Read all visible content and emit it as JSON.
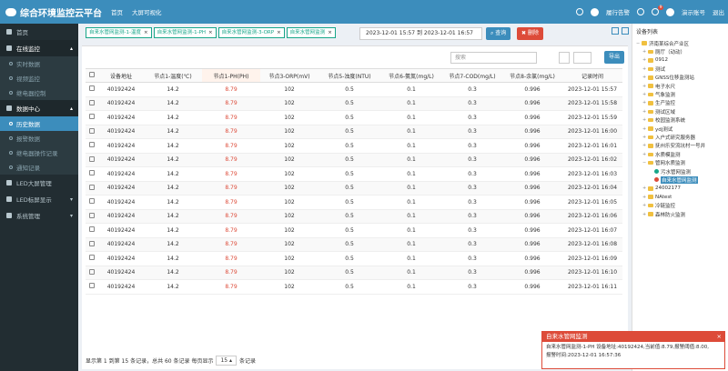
{
  "header": {
    "title": "综合环境监控云平台",
    "nav": [
      "首页",
      "大屏可视化"
    ],
    "alarm_label": "履行告警",
    "user_label": "演示账号",
    "logout_label": "退出",
    "badge_count": "9"
  },
  "sidebar": {
    "items": [
      {
        "label": "首页",
        "type": "item"
      },
      {
        "label": "在线监控",
        "type": "group"
      },
      {
        "label": "实时数据",
        "type": "sub"
      },
      {
        "label": "视频监控",
        "type": "sub"
      },
      {
        "label": "继电器控制",
        "type": "sub"
      },
      {
        "label": "数据中心",
        "type": "group"
      },
      {
        "label": "历史数据",
        "type": "sub",
        "active": true
      },
      {
        "label": "报警数据",
        "type": "sub"
      },
      {
        "label": "继电器操作记录",
        "type": "sub"
      },
      {
        "label": "通知记录",
        "type": "sub"
      },
      {
        "label": "LED大屏管理",
        "type": "item"
      },
      {
        "label": "LED标屏显示",
        "type": "item"
      },
      {
        "label": "系统管理",
        "type": "item"
      }
    ]
  },
  "tags": [
    "自来水管网监测-1-温度",
    "自来水管网监测-1-PH",
    "自来水管网监测-3-ORP",
    "自来水管网监测"
  ],
  "date_range": "2023-12-01 15:57 到 2023-12-01 16:57",
  "query_label": "查询",
  "delete_label": "删除",
  "search_placeholder": "搜索",
  "export_label": "导出",
  "table": {
    "columns": [
      "设备地址",
      "节点1-温度(℃)",
      "节点1-PH(PH)",
      "节点3-ORP(mV)",
      "节点5-浊度(NTU)",
      "节点6-氨氮(mg/L)",
      "节点7-COD(mg/L)",
      "节点8-余氯(mg/L)",
      "记录时间"
    ],
    "rows": [
      [
        "40192424",
        "14.2",
        "8.79",
        "102",
        "0.5",
        "0.1",
        "0.3",
        "0.996",
        "2023-12-01 15:57"
      ],
      [
        "40192424",
        "14.2",
        "8.79",
        "102",
        "0.5",
        "0.1",
        "0.3",
        "0.996",
        "2023-12-01 15:58"
      ],
      [
        "40192424",
        "14.2",
        "8.79",
        "102",
        "0.5",
        "0.1",
        "0.3",
        "0.996",
        "2023-12-01 15:59"
      ],
      [
        "40192424",
        "14.2",
        "8.79",
        "102",
        "0.5",
        "0.1",
        "0.3",
        "0.996",
        "2023-12-01 16:00"
      ],
      [
        "40192424",
        "14.2",
        "8.79",
        "102",
        "0.5",
        "0.1",
        "0.3",
        "0.996",
        "2023-12-01 16:01"
      ],
      [
        "40192424",
        "14.2",
        "8.79",
        "102",
        "0.5",
        "0.1",
        "0.3",
        "0.996",
        "2023-12-01 16:02"
      ],
      [
        "40192424",
        "14.2",
        "8.79",
        "102",
        "0.5",
        "0.1",
        "0.3",
        "0.996",
        "2023-12-01 16:03"
      ],
      [
        "40192424",
        "14.2",
        "8.79",
        "102",
        "0.5",
        "0.1",
        "0.3",
        "0.996",
        "2023-12-01 16:04"
      ],
      [
        "40192424",
        "14.2",
        "8.79",
        "102",
        "0.5",
        "0.1",
        "0.3",
        "0.996",
        "2023-12-01 16:05"
      ],
      [
        "40192424",
        "14.2",
        "8.79",
        "102",
        "0.5",
        "0.1",
        "0.3",
        "0.996",
        "2023-12-01 16:06"
      ],
      [
        "40192424",
        "14.2",
        "8.79",
        "102",
        "0.5",
        "0.1",
        "0.3",
        "0.996",
        "2023-12-01 16:07"
      ],
      [
        "40192424",
        "14.2",
        "8.79",
        "102",
        "0.5",
        "0.1",
        "0.3",
        "0.996",
        "2023-12-01 16:08"
      ],
      [
        "40192424",
        "14.2",
        "8.79",
        "102",
        "0.5",
        "0.1",
        "0.3",
        "0.996",
        "2023-12-01 16:09"
      ],
      [
        "40192424",
        "14.2",
        "8.79",
        "102",
        "0.5",
        "0.1",
        "0.3",
        "0.996",
        "2023-12-01 16:10"
      ],
      [
        "40192424",
        "14.2",
        "8.79",
        "102",
        "0.5",
        "0.1",
        "0.3",
        "0.996",
        "2023-12-01 16:11"
      ]
    ]
  },
  "footer": {
    "summary": "显示第 1 到第 15 条记录，总共 60 条记录 每页显示",
    "page_size": "15",
    "suffix": "条记录"
  },
  "tree": {
    "title": "设备列表",
    "nodes": [
      {
        "label": "济南某综合产业区",
        "depth": 0,
        "kind": "folder",
        "pm": "−"
      },
      {
        "label": "厕厅（动动）",
        "depth": 1,
        "kind": "folder",
        "pm": "+"
      },
      {
        "label": "0912",
        "depth": 1,
        "kind": "folder",
        "pm": "+"
      },
      {
        "label": "测试",
        "depth": 1,
        "kind": "folder",
        "pm": "+"
      },
      {
        "label": "GNSS位移监测站",
        "depth": 1,
        "kind": "folder",
        "pm": "+"
      },
      {
        "label": "电子水尺",
        "depth": 1,
        "kind": "folder",
        "pm": "+"
      },
      {
        "label": "气象监测",
        "depth": 1,
        "kind": "folder",
        "pm": "+"
      },
      {
        "label": "生产监控",
        "depth": 1,
        "kind": "folder",
        "pm": "+"
      },
      {
        "label": "测试区域",
        "depth": 1,
        "kind": "folder",
        "pm": "+"
      },
      {
        "label": "校园监测系统",
        "depth": 1,
        "kind": "folder",
        "pm": "+"
      },
      {
        "label": "ydj测试",
        "depth": 1,
        "kind": "folder",
        "pm": "+"
      },
      {
        "label": "入户式研究服务器",
        "depth": 1,
        "kind": "folder",
        "pm": "+"
      },
      {
        "label": "抚州乐安流坑村一号井",
        "depth": 1,
        "kind": "folder",
        "pm": "+"
      },
      {
        "label": "水质模监测",
        "depth": 1,
        "kind": "folder",
        "pm": "+"
      },
      {
        "label": "管网水质监测",
        "depth": 1,
        "kind": "folder",
        "pm": "−"
      },
      {
        "label": "污水管网监测",
        "depth": 2,
        "kind": "green",
        "pm": ""
      },
      {
        "label": "自来水管网监测",
        "depth": 2,
        "kind": "red",
        "pm": "",
        "selected": true
      },
      {
        "label": "24002177",
        "depth": 1,
        "kind": "folder",
        "pm": "+"
      },
      {
        "label": "NAtest",
        "depth": 1,
        "kind": "folder",
        "pm": "+"
      },
      {
        "label": "冷链监控",
        "depth": 1,
        "kind": "folder",
        "pm": "+"
      },
      {
        "label": "森林防火监测",
        "depth": 1,
        "kind": "folder",
        "pm": "+"
      }
    ]
  },
  "toast": {
    "title": "自来水管网监测",
    "line1": "自来水管网监测-1-PH 设备地址:40192424,当前值:8.79,报警阈值:8.00,",
    "line2": "报警时间:2023-12-01 16:57:36"
  },
  "colors": {
    "primary": "#3c8dbc",
    "danger": "#dd4b39",
    "success": "#18a689",
    "sidebar": "#222d32"
  }
}
